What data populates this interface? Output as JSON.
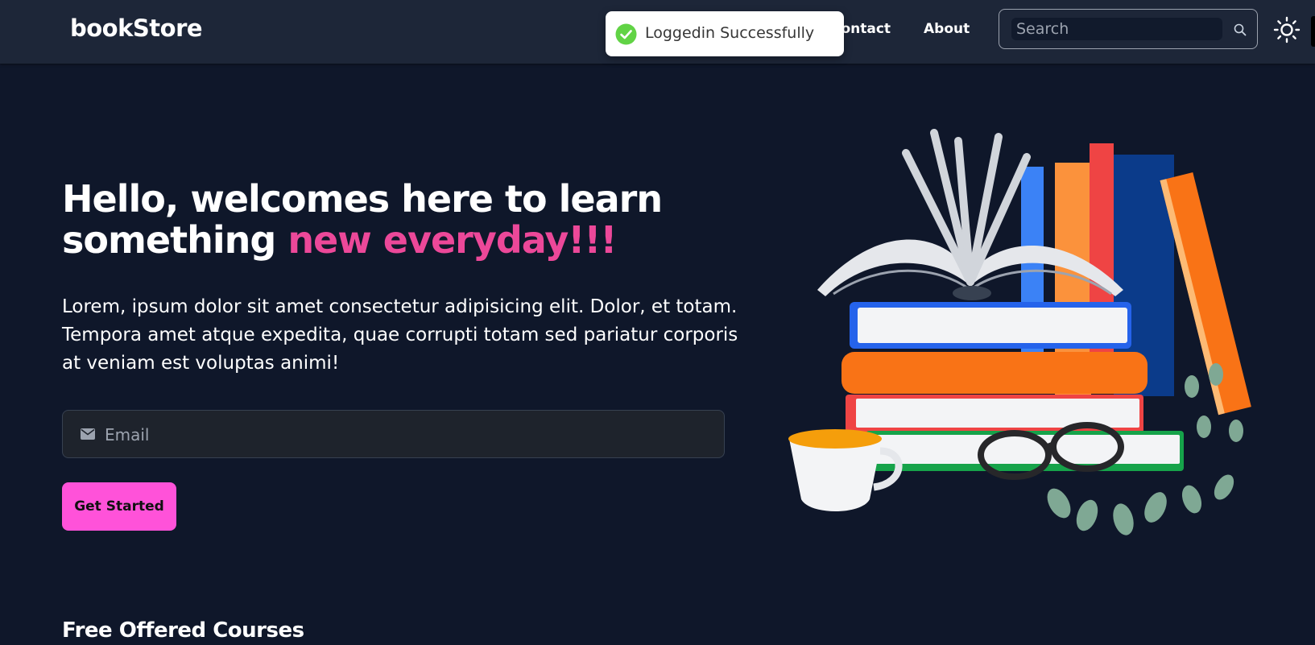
{
  "navbar": {
    "brand": "bookStore",
    "links": [
      {
        "label": "Contact"
      },
      {
        "label": "About"
      }
    ],
    "search": {
      "placeholder": "Search",
      "value": ""
    }
  },
  "toast": {
    "message": "Loggedin Successfully",
    "icon": "check-circle-icon",
    "color": "#61d345"
  },
  "hero": {
    "title_part1": "Hello, welcomes here to learn something ",
    "title_accent": "new everyday!!!",
    "description": "Lorem, ipsum dolor sit amet consectetur adipisicing elit. Dolor, et totam. Tempora amet atque expedita, quae corrupti totam sed pariatur corporis at veniam est voluptas animi!",
    "email": {
      "placeholder": "Email",
      "value": ""
    },
    "cta_label": "Get Started"
  },
  "section": {
    "title": "Free Offered Courses"
  },
  "colors": {
    "background": "#0f172a",
    "navbar": "#1d2638",
    "accent": "#ec4899",
    "button": "#ff52d9"
  }
}
